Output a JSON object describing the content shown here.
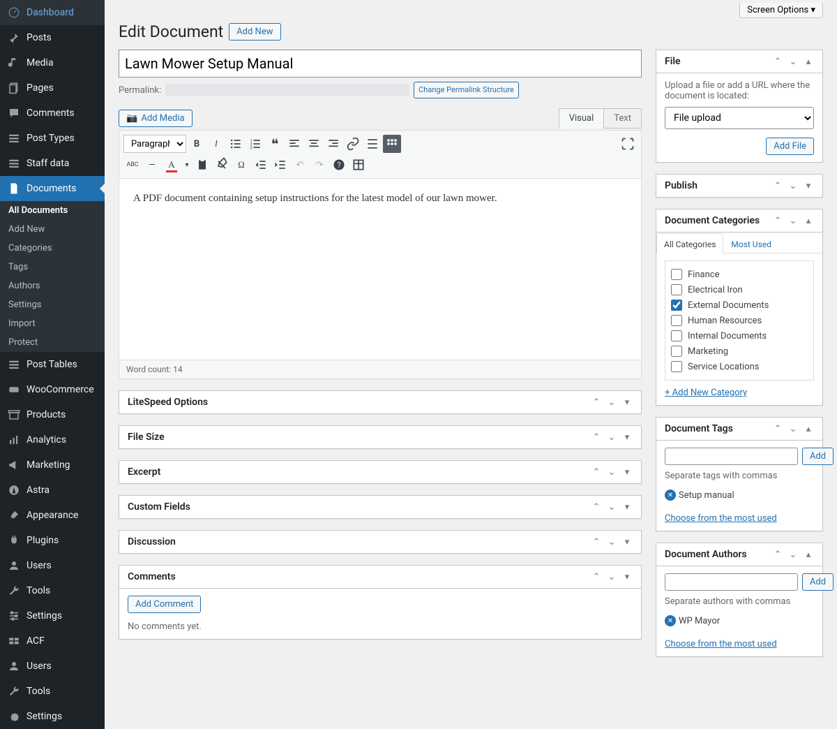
{
  "screenOptions": "Screen Options",
  "pageTitle": "Edit Document",
  "addNew": "Add New",
  "sidebar": {
    "items": [
      {
        "label": "Dashboard",
        "icon": "dashboard"
      },
      {
        "label": "Posts",
        "icon": "pin"
      },
      {
        "label": "Media",
        "icon": "media"
      },
      {
        "label": "Pages",
        "icon": "pages"
      },
      {
        "label": "Comments",
        "icon": "comment"
      },
      {
        "label": "Post Types",
        "icon": "list"
      },
      {
        "label": "Staff data",
        "icon": "list"
      },
      {
        "label": "Documents",
        "icon": "document",
        "current": true
      },
      {
        "label": "Post Tables",
        "icon": "list"
      },
      {
        "label": "WooCommerce",
        "icon": "woo"
      },
      {
        "label": "Products",
        "icon": "archive"
      },
      {
        "label": "Analytics",
        "icon": "chart"
      },
      {
        "label": "Marketing",
        "icon": "megaphone"
      },
      {
        "label": "Astra",
        "icon": "astra"
      },
      {
        "label": "Appearance",
        "icon": "brush"
      },
      {
        "label": "Plugins",
        "icon": "plug"
      },
      {
        "label": "Users",
        "icon": "user"
      },
      {
        "label": "Tools",
        "icon": "wrench"
      },
      {
        "label": "Settings",
        "icon": "sliders"
      },
      {
        "label": "ACF",
        "icon": "acf"
      },
      {
        "label": "Users",
        "icon": "user"
      },
      {
        "label": "Tools",
        "icon": "wrench"
      },
      {
        "label": "Settings",
        "icon": "gear"
      }
    ],
    "submenu": [
      "All Documents",
      "Add New",
      "Categories",
      "Tags",
      "Authors",
      "Settings",
      "Import",
      "Protect"
    ]
  },
  "document": {
    "title": "Lawn Mower Setup Manual",
    "permalinkLabel": "Permalink:",
    "changePermalinkBtn": "Change Permalink Structure",
    "addMedia": "Add Media",
    "visualTab": "Visual",
    "textTab": "Text",
    "formatSelect": "Paragraph",
    "content": "A PDF document containing setup instructions for the latest model of our lawn mower.",
    "wordCount": "Word count: 14"
  },
  "metaboxes": {
    "titles": [
      "LiteSpeed Options",
      "File Size",
      "Excerpt",
      "Custom Fields",
      "Discussion",
      "Comments"
    ],
    "addComment": "Add Comment",
    "noComments": "No comments yet."
  },
  "fileBox": {
    "title": "File",
    "help": "Upload a file or add a URL where the document is located:",
    "selectValue": "File upload",
    "addFile": "Add File"
  },
  "publishBox": {
    "title": "Publish"
  },
  "categoriesBox": {
    "title": "Document Categories",
    "tabAll": "All Categories",
    "tabMost": "Most Used",
    "items": [
      {
        "label": "Finance",
        "checked": false
      },
      {
        "label": "Electrical Iron",
        "checked": false
      },
      {
        "label": "External Documents",
        "checked": true
      },
      {
        "label": "Human Resources",
        "checked": false
      },
      {
        "label": "Internal Documents",
        "checked": false
      },
      {
        "label": "Marketing",
        "checked": false
      },
      {
        "label": "Service Locations",
        "checked": false
      }
    ],
    "addNew": "+ Add New Category"
  },
  "tagsBox": {
    "title": "Document Tags",
    "addBtn": "Add",
    "help": "Separate tags with commas",
    "tag": "Setup manual",
    "chooseLink": "Choose from the most used"
  },
  "authorsBox": {
    "title": "Document Authors",
    "addBtn": "Add",
    "help": "Separate authors with commas",
    "author": "WP Mayor",
    "chooseLink": "Choose from the most used"
  }
}
